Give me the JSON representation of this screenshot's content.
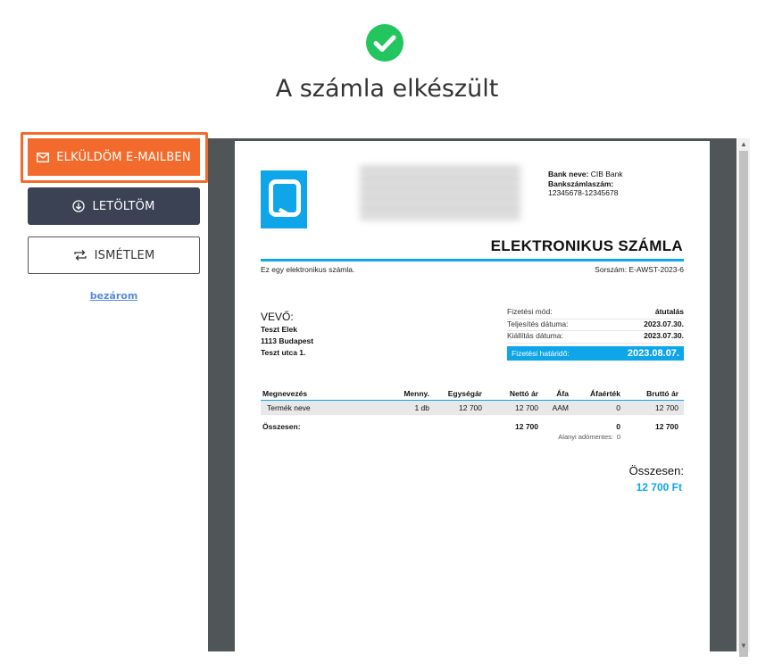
{
  "header": {
    "title": "A számla elkészült"
  },
  "actions": {
    "email_label": "ELKÜLDÖM E-MAILBEN",
    "download_label": "LETÖLTÖM",
    "repeat_label": "ISMÉTLEM",
    "close_label": "bezárom"
  },
  "invoice": {
    "bank_name_label": "Bank neve:",
    "bank_name": "CIB Bank",
    "account_label": "Bankszámlaszám:",
    "account_number": "12345678-12345678",
    "doc_title": "ELEKTRONIKUS SZÁMLA",
    "subtitle": "Ez egy elektronikus számla.",
    "serial": "Sorszám: E-AWST-2023-6",
    "buyer_heading": "VEVŐ:",
    "buyer_name": "Teszt Elek",
    "buyer_city": "1113 Budapest",
    "buyer_street": "Teszt utca 1.",
    "payment": {
      "method_label": "Fizetési mód:",
      "method": "átutalás",
      "fulfillment_label": "Teljesítés dátuma:",
      "fulfillment_date": "2023.07.30.",
      "issue_label": "Kiállítás dátuma:",
      "issue_date": "2023.07.30.",
      "due_label": "Fizetési határidő:",
      "due_date": "2023.08.07."
    },
    "table": {
      "headers": [
        "Megnevezés",
        "Menny.",
        "Egységár",
        "Nettó ár",
        "Áfa",
        "Áfaérték",
        "Bruttó ár"
      ],
      "rows": [
        [
          "Termék neve",
          "1 db",
          "12 700",
          "12 700",
          "AAM",
          "0",
          "12 700"
        ]
      ],
      "sum_label": "Összesen:",
      "sum_net": "12 700",
      "sum_vat": "0",
      "sum_gross": "12 700",
      "vat_note": "Alanyi adómentes:",
      "vat_note_value": "0"
    },
    "total_label": "Összesen:",
    "total_value": "12 700 Ft"
  },
  "colors": {
    "accent": "#f26b2d",
    "dark_button": "#3a4254",
    "invoice_blue": "#0ea5e9",
    "success": "#22c55e"
  }
}
